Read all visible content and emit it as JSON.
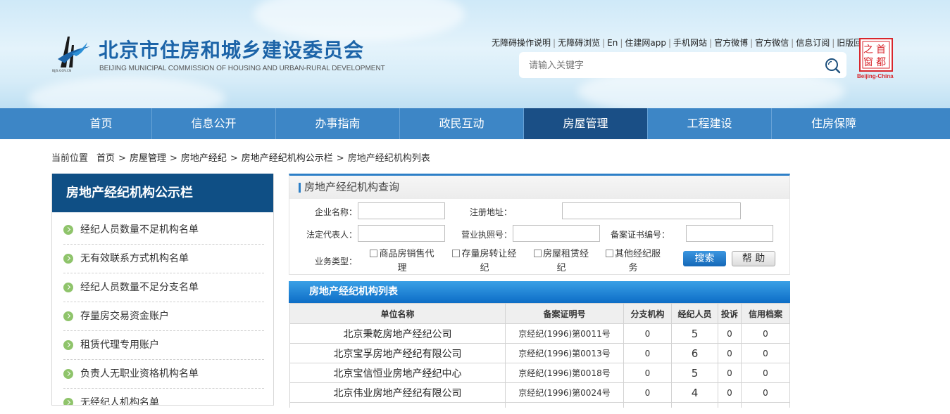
{
  "header": {
    "org_cn": "北京市住房和城乡建设委员会",
    "org_en": "BEIJING MUNICIPAL COMMISSION OF HOUSING AND URBAN-RURAL DEVELOPMENT",
    "logo_small_text": "BJJS.GOV.CN",
    "top_links": [
      "无障碍操作说明",
      "无障碍浏览",
      "En",
      "住建网app",
      "手机网站",
      "官方微博",
      "官方微信",
      "信息订阅",
      "旧版回顾"
    ],
    "search_placeholder": "请输入关键字",
    "capital_logo": {
      "chars": [
        "之",
        "首",
        "窗",
        "都"
      ],
      "caption": "Beijing-China"
    }
  },
  "nav": {
    "items": [
      "首页",
      "信息公开",
      "办事指南",
      "政民互动",
      "房屋管理",
      "工程建设",
      "住房保障"
    ],
    "active": "房屋管理"
  },
  "breadcrumb": {
    "label": "当前位置",
    "items": [
      "首页",
      "房屋管理",
      "房地产经纪",
      "房地产经纪机构公示栏",
      "房地产经纪机构列表"
    ],
    "separator": ">"
  },
  "sidebar": {
    "title": "房地产经纪机构公示栏",
    "items": [
      "经纪人员数量不足机构名单",
      "无有效联系方式机构名单",
      "经纪人员数量不足分支名单",
      "存量房交易资金账户",
      "租赁代理专用账户",
      "负责人无职业资格机构名单",
      "无经纪人机构名单"
    ]
  },
  "query": {
    "title": "房地产经纪机构查询",
    "labels": {
      "company": "企业名称：",
      "address": "注册地址：",
      "legal_rep": "法定代表人：",
      "license": "营业执照号：",
      "record_no": "备案证书编号：",
      "biz_type": "业务类型："
    },
    "biz_types": [
      [
        "商品房销售代",
        "理"
      ],
      [
        "存量房转让经",
        "纪"
      ],
      [
        "房屋租赁经",
        "纪"
      ],
      [
        "其他经纪服",
        "务"
      ]
    ],
    "search_label": "搜索",
    "help_label": "帮 助"
  },
  "result": {
    "title": "房地产经纪机构列表",
    "columns": [
      "单位名称",
      "备案证明号",
      "分支机构",
      "经纪人员",
      "投诉",
      "信用档案"
    ],
    "rows": [
      [
        "北京秉乾房地产经纪公司",
        "京经纪(1996)第0011号",
        "0",
        "5",
        "0",
        "0"
      ],
      [
        "北京宝孚房地产经纪有限公司",
        "京经纪(1996)第0013号",
        "0",
        "6",
        "0",
        "0"
      ],
      [
        "北京宝信恒业房地产经纪中心",
        "京经纪(1996)第0018号",
        "0",
        "5",
        "0",
        "0"
      ],
      [
        "北京伟业房地产经纪有限公司",
        "京经纪(1996)第0024号",
        "0",
        "4",
        "0",
        "0"
      ],
      [
        "",
        "",
        "",
        "",
        "",
        ""
      ]
    ]
  },
  "colors": {
    "nav_bg": "#3d86c6",
    "nav_active": "#1a4f86",
    "sidebar_head": "#0f4f85",
    "accent_blue": "#2d7fc7",
    "bullet_green": "#8fc46b",
    "title_blue": "#1c64a8",
    "capital_red": "#d8262c"
  },
  "icons": {
    "search": "magnifier-icon",
    "bullet": "arrow-circle-icon"
  }
}
